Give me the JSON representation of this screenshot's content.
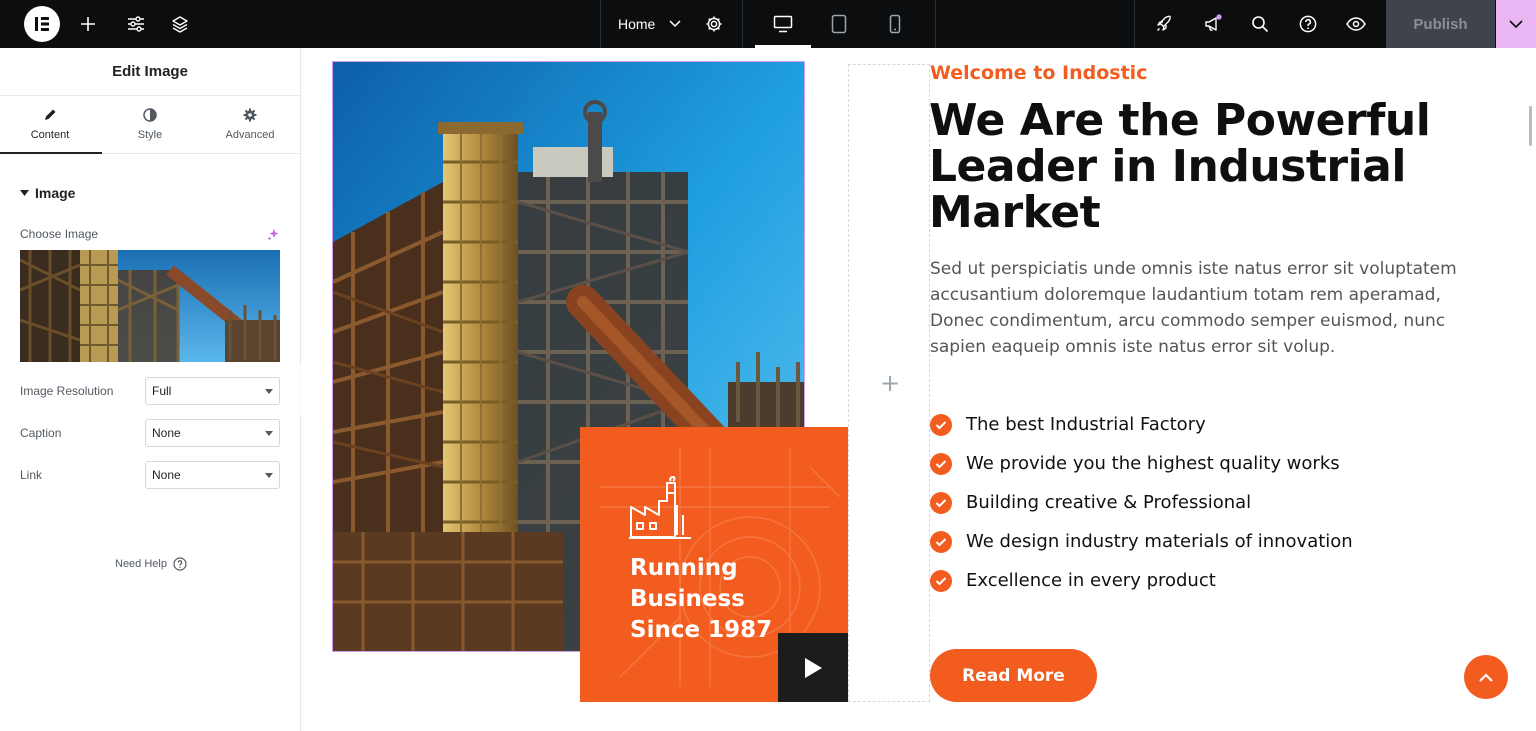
{
  "topbar": {
    "page_selector": "Home",
    "publish_label": "Publish"
  },
  "panel": {
    "title": "Edit Image",
    "tabs": [
      {
        "label": "Content"
      },
      {
        "label": "Style"
      },
      {
        "label": "Advanced"
      }
    ],
    "section_title": "Image",
    "choose_image_label": "Choose Image",
    "fields": {
      "resolution": {
        "label": "Image Resolution",
        "value": "Full"
      },
      "caption": {
        "label": "Caption",
        "value": "None"
      },
      "link": {
        "label": "Link",
        "value": "None"
      }
    },
    "need_help": "Need Help"
  },
  "canvas": {
    "card": {
      "line1": "Running",
      "line2": "Business",
      "line3": "Since 1987"
    },
    "subtitle": "Welcome to Indostic",
    "heading": "We Are the Powerful Leader in Industrial Market",
    "paragraph": "Sed ut perspiciatis unde omnis iste natus error sit voluptatem accusantium doloremque laudantium totam rem aperamad, Donec condimentum, arcu commodo semper euismod, nunc sapien eaqueip omnis iste natus error sit volup.",
    "features": [
      "The best Industrial Factory",
      "We provide you the highest quality works",
      "Building creative & Professional",
      "We design industry materials of innovation",
      "Excellence in every product"
    ],
    "button_label": "Read More"
  },
  "colors": {
    "accent": "#f25d1f",
    "topbar_bg": "#0c0d0e",
    "publish_bg": "#3f444b",
    "publish_more_bg": "#e9b6f3",
    "selection_border": "#d39ef0"
  }
}
